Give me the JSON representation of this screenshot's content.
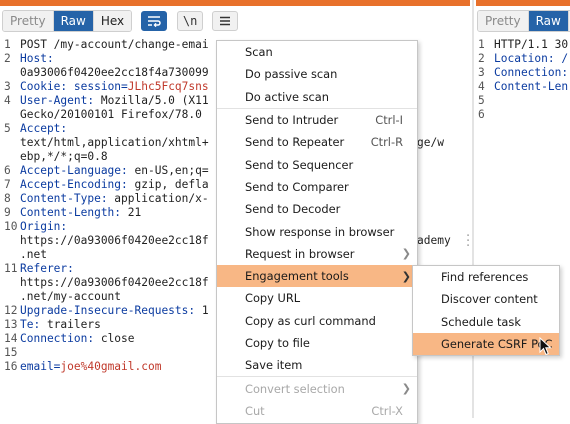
{
  "request_panel": {
    "tabs": [
      "Pretty",
      "Raw",
      "Hex"
    ],
    "active_tab": "Raw",
    "wrap_icon": "wrap-lines-icon",
    "newline_toggle": "\\n",
    "menu_icon": "hamburger-menu-icon",
    "lines": [
      {
        "num": "1",
        "parts": [
          {
            "t": "POST /my-account/change-emai",
            "c": "code"
          }
        ]
      },
      {
        "num": "2",
        "parts": [
          {
            "t": "Host:",
            "c": "hdr"
          }
        ]
      },
      {
        "num": "",
        "parts": [
          {
            "t": "0a93006f0420ee2cc18f4a730099",
            "c": "code"
          }
        ]
      },
      {
        "num": "3",
        "parts": [
          {
            "t": "Cookie: ",
            "c": "hdr"
          },
          {
            "t": "session=",
            "c": "hdr"
          },
          {
            "t": "JLhc5Fcq7sns",
            "c": "cookieval"
          }
        ]
      },
      {
        "num": "4",
        "parts": [
          {
            "t": "User-Agent: ",
            "c": "hdr"
          },
          {
            "t": "Mozilla/5.0 (X11",
            "c": "code"
          }
        ]
      },
      {
        "num": "",
        "parts": [
          {
            "t": "Gecko/20100101 Firefox/78.0",
            "c": "code"
          }
        ]
      },
      {
        "num": "5",
        "parts": [
          {
            "t": "Accept:",
            "c": "hdr"
          }
        ]
      },
      {
        "num": "",
        "parts": [
          {
            "t": "text/html,application/xhtml+",
            "c": "code"
          }
        ]
      },
      {
        "num": "",
        "parts": [
          {
            "t": "ebp,*/*;q=0.8",
            "c": "code"
          }
        ]
      },
      {
        "num": "6",
        "parts": [
          {
            "t": "Accept-Language: ",
            "c": "hdr"
          },
          {
            "t": "en-US,en;q=",
            "c": "code"
          }
        ]
      },
      {
        "num": "7",
        "parts": [
          {
            "t": "Accept-Encoding: ",
            "c": "hdr"
          },
          {
            "t": "gzip, defla",
            "c": "code"
          }
        ]
      },
      {
        "num": "8",
        "parts": [
          {
            "t": "Content-Type: ",
            "c": "hdr"
          },
          {
            "t": "application/x-",
            "c": "code"
          }
        ]
      },
      {
        "num": "9",
        "parts": [
          {
            "t": "Content-Length: ",
            "c": "hdr"
          },
          {
            "t": "21",
            "c": "code"
          }
        ]
      },
      {
        "num": "10",
        "parts": [
          {
            "t": "Origin:",
            "c": "hdr"
          }
        ]
      },
      {
        "num": "",
        "parts": [
          {
            "t": "https://0a93006f0420ee2cc18f",
            "c": "code"
          }
        ]
      },
      {
        "num": "",
        "parts": [
          {
            "t": ".net",
            "c": "code"
          }
        ]
      },
      {
        "num": "11",
        "parts": [
          {
            "t": "Referer:",
            "c": "hdr"
          }
        ]
      },
      {
        "num": "",
        "parts": [
          {
            "t": "https://0a93006f0420ee2cc18f",
            "c": "code"
          }
        ]
      },
      {
        "num": "",
        "parts": [
          {
            "t": ".net/my-account",
            "c": "code"
          }
        ]
      },
      {
        "num": "12",
        "parts": [
          {
            "t": "Upgrade-Insecure-Requests: ",
            "c": "hdr"
          },
          {
            "t": "1",
            "c": "code"
          }
        ]
      },
      {
        "num": "13",
        "parts": [
          {
            "t": "Te: ",
            "c": "hdr"
          },
          {
            "t": "trailers",
            "c": "code"
          }
        ]
      },
      {
        "num": "14",
        "parts": [
          {
            "t": "Connection: ",
            "c": "hdr"
          },
          {
            "t": "close",
            "c": "code"
          }
        ]
      },
      {
        "num": "15",
        "parts": []
      },
      {
        "num": "16",
        "parts": [
          {
            "t": "email=",
            "c": "bodyparam"
          },
          {
            "t": "joe%40gmail.com",
            "c": "bodyval"
          }
        ]
      }
    ],
    "overflow_fragments": [
      "ge/w",
      "ademy"
    ]
  },
  "response_panel": {
    "tabs": [
      "Pretty",
      "Raw",
      "H"
    ],
    "active_tab": "Raw",
    "lines": [
      {
        "num": "1",
        "parts": [
          {
            "t": "HTTP/1.1 30",
            "c": "code"
          }
        ]
      },
      {
        "num": "2",
        "parts": [
          {
            "t": "Location: /",
            "c": "hdr"
          }
        ]
      },
      {
        "num": "3",
        "parts": [
          {
            "t": "Connection:",
            "c": "hdr"
          }
        ]
      },
      {
        "num": "4",
        "parts": [
          {
            "t": "Content-Len",
            "c": "hdr"
          }
        ]
      },
      {
        "num": "5",
        "parts": []
      },
      {
        "num": "6",
        "parts": []
      }
    ]
  },
  "context_menu": {
    "items": [
      {
        "label": "Scan",
        "shortcut": "",
        "submenu": false,
        "disabled": false,
        "highlight": false,
        "sep_after": false
      },
      {
        "label": "Do passive scan",
        "shortcut": "",
        "submenu": false,
        "disabled": false,
        "highlight": false,
        "sep_after": false
      },
      {
        "label": "Do active scan",
        "shortcut": "",
        "submenu": false,
        "disabled": false,
        "highlight": false,
        "sep_after": true
      },
      {
        "label": "Send to Intruder",
        "shortcut": "Ctrl-I",
        "submenu": false,
        "disabled": false,
        "highlight": false,
        "sep_after": false
      },
      {
        "label": "Send to Repeater",
        "shortcut": "Ctrl-R",
        "submenu": false,
        "disabled": false,
        "highlight": false,
        "sep_after": false
      },
      {
        "label": "Send to Sequencer",
        "shortcut": "",
        "submenu": false,
        "disabled": false,
        "highlight": false,
        "sep_after": false
      },
      {
        "label": "Send to Comparer",
        "shortcut": "",
        "submenu": false,
        "disabled": false,
        "highlight": false,
        "sep_after": false
      },
      {
        "label": "Send to Decoder",
        "shortcut": "",
        "submenu": false,
        "disabled": false,
        "highlight": false,
        "sep_after": false
      },
      {
        "label": "Show response in browser",
        "shortcut": "",
        "submenu": false,
        "disabled": false,
        "highlight": false,
        "sep_after": false
      },
      {
        "label": "Request in browser",
        "shortcut": "",
        "submenu": true,
        "disabled": false,
        "highlight": false,
        "sep_after": false
      },
      {
        "label": "Engagement tools",
        "shortcut": "",
        "submenu": true,
        "disabled": false,
        "highlight": true,
        "sep_after": false
      },
      {
        "label": "Copy URL",
        "shortcut": "",
        "submenu": false,
        "disabled": false,
        "highlight": false,
        "sep_after": false
      },
      {
        "label": "Copy as curl command",
        "shortcut": "",
        "submenu": false,
        "disabled": false,
        "highlight": false,
        "sep_after": false
      },
      {
        "label": "Copy to file",
        "shortcut": "",
        "submenu": false,
        "disabled": false,
        "highlight": false,
        "sep_after": false
      },
      {
        "label": "Save item",
        "shortcut": "",
        "submenu": false,
        "disabled": false,
        "highlight": false,
        "sep_after": true
      },
      {
        "label": "Convert selection",
        "shortcut": "",
        "submenu": true,
        "disabled": true,
        "highlight": false,
        "sep_after": false
      },
      {
        "label": "Cut",
        "shortcut": "Ctrl-X",
        "submenu": false,
        "disabled": true,
        "highlight": false,
        "sep_after": false
      }
    ]
  },
  "submenu": {
    "items": [
      {
        "label": "Find references",
        "highlight": false
      },
      {
        "label": "Discover content",
        "highlight": false
      },
      {
        "label": "Schedule task",
        "highlight": false
      },
      {
        "label": "Generate CSRF PoC",
        "highlight": true
      }
    ]
  },
  "colors": {
    "accent": "#2563a8",
    "highlight": "#f8b785",
    "header_key": "#0b3ba0",
    "value_red": "#c0392b",
    "top_strip": "#e8712b"
  }
}
